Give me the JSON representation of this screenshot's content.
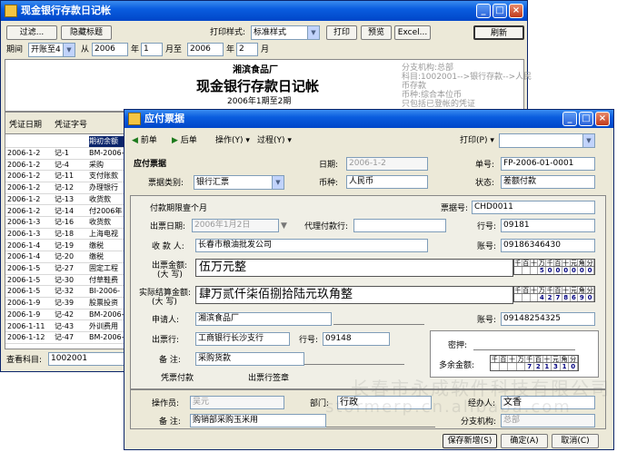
{
  "back": {
    "title": "现金银行存款日记帐",
    "toolbar": {
      "filter": "过滤...",
      "hide_title": "隐藏标题",
      "print_style_label": "打印样式:",
      "print_style_value": "标准样式",
      "print": "打印",
      "preview": "预览",
      "excel": "Excel...",
      "refresh": "刷新"
    },
    "period": {
      "label": "期间",
      "mode": "开账至4",
      "from": "从",
      "y1": "2006",
      "year": "年",
      "m1": "1",
      "month_to": "月至",
      "y2": "2006",
      "m2": "2",
      "month": "月"
    },
    "report": {
      "company": "湘滨食品厂",
      "title": "现金银行存款日记帐",
      "range": "2006年1期至2期",
      "info": [
        "分支机构:总部",
        "科目:1002001-->银行存款-->人民",
        "币存款",
        "币种:综合本位币",
        "只包括已登帐的凭证"
      ]
    },
    "grid": {
      "headers": [
        "凭证日期",
        "凭证字号"
      ],
      "first_row": "期初余额",
      "rows": [
        [
          "2006-1-2",
          "记-1",
          "BM-2006-"
        ],
        [
          "2006-1-2",
          "记-4",
          "采购"
        ],
        [
          "2006-1-2",
          "记-11",
          "支付账款"
        ],
        [
          "2006-1-2",
          "记-12",
          "办理银行"
        ],
        [
          "2006-1-2",
          "记-13",
          "收货款"
        ],
        [
          "2006-1-2",
          "记-14",
          "付2006年"
        ],
        [
          "2006-1-3",
          "记-16",
          "收货款"
        ],
        [
          "2006-1-3",
          "记-18",
          "上海电视"
        ],
        [
          "2006-1-4",
          "记-19",
          "缴税"
        ],
        [
          "2006-1-4",
          "记-20",
          "缴税"
        ],
        [
          "2006-1-5",
          "记-27",
          "固定工程"
        ],
        [
          "2006-1-5",
          "记-30",
          "付草鞋费"
        ],
        [
          "2006-1-5",
          "记-32",
          "BI-2006-"
        ],
        [
          "2006-1-9",
          "记-39",
          "股票投资"
        ],
        [
          "2006-1-9",
          "记-42",
          "BM-2006-"
        ],
        [
          "2006-1-11",
          "记-43",
          "外训费用"
        ],
        [
          "2006-1-12",
          "记-47",
          "BM-2006-"
        ]
      ]
    },
    "subject_label": "查看科目:",
    "subject_value": "1002001"
  },
  "front": {
    "title": "应付票据",
    "toolbar": {
      "prev": "前单",
      "next": "后单",
      "action": "操作(Y)",
      "process": "过程(Y)",
      "print": "打印(P)"
    },
    "header": {
      "doc_type": "应付票据",
      "date_label": "日期:",
      "date_value": "2006-1-2",
      "number_label": "单号:",
      "number_value": "FP-2006-01-0001",
      "category_label": "票据类别:",
      "category_value": "银行汇票",
      "currency_label": "币种:",
      "currency_value": "人民币",
      "status_label": "状态:",
      "status_value": "差额付款"
    },
    "body": {
      "note_line": "付款期限壹个月",
      "voucher_no_label": "票据号:",
      "voucher_no_value": "CHD0011",
      "issue_date_label": "出票日期:",
      "issue_date_value": "2006年1月2日",
      "agent_bank_label": "代理付款行:",
      "agent_bank_value": "",
      "bank_no_label": "行号:",
      "bank_no_value": "09181",
      "payee_label": "收 款 人:",
      "payee_value": "长春市粮油批发公司",
      "account_label": "账号:",
      "account_value": "09186346430",
      "amount_label_1": "出票金额:",
      "amount_label_2": "(大 写)",
      "amount_words": "伍万元整",
      "settle_label_1": "实际结算金额:",
      "settle_label_2": "(大 写)",
      "settle_words": "肆万贰仟柒佰捌拾陆元玖角整",
      "digit_headers": [
        "千",
        "百",
        "十",
        "万",
        "千",
        "百",
        "十",
        "元",
        "角",
        "分"
      ],
      "amount_digits": [
        "",
        "",
        "",
        "5",
        "0",
        "0",
        "0",
        "0",
        "0",
        "0"
      ],
      "settle_digits": [
        "",
        "",
        "",
        "4",
        "2",
        "7",
        "8",
        "6",
        "9",
        "0"
      ],
      "applicant_label": "申请人:",
      "applicant_value": "湘滨食品厂",
      "account2_label": "账号:",
      "account2_value": "09148254325",
      "issuer_bank_label": "出票行:",
      "issuer_bank_value": "工商银行长沙支行",
      "bank_no2_label": "行号:",
      "bank_no2_value": "09148",
      "memo_label": "备 注:",
      "memo_value": "采购货款",
      "password_label": "密押:",
      "remain_label": "多余金额:",
      "remain_headers": [
        "千",
        "百",
        "十",
        "万",
        "千",
        "百",
        "十",
        "元",
        "角",
        "分"
      ],
      "remain_digits": [
        "",
        "",
        "",
        "",
        "7",
        "2",
        "1",
        "3",
        "1",
        "0"
      ],
      "voucher_pay": "凭票付款",
      "issuer_seal": "出票行签章"
    },
    "footer": {
      "operator_label": "操作员:",
      "operator_value": "吴元",
      "dept_label": "部门:",
      "dept_value": "行政",
      "handler_label": "经办人:",
      "handler_value": "文香",
      "memo_label": "备 注:",
      "memo_value": "购销部采购玉米用",
      "branch_label": "分支机构:",
      "branch_value": "总部",
      "save_new": "保存新增(S)",
      "ok": "确定(A)",
      "cancel": "取消(C)"
    }
  },
  "watermark": {
    "cn": "长春市永成软件科技有限公司",
    "url": "stormerp.cn.alibaba.com"
  }
}
